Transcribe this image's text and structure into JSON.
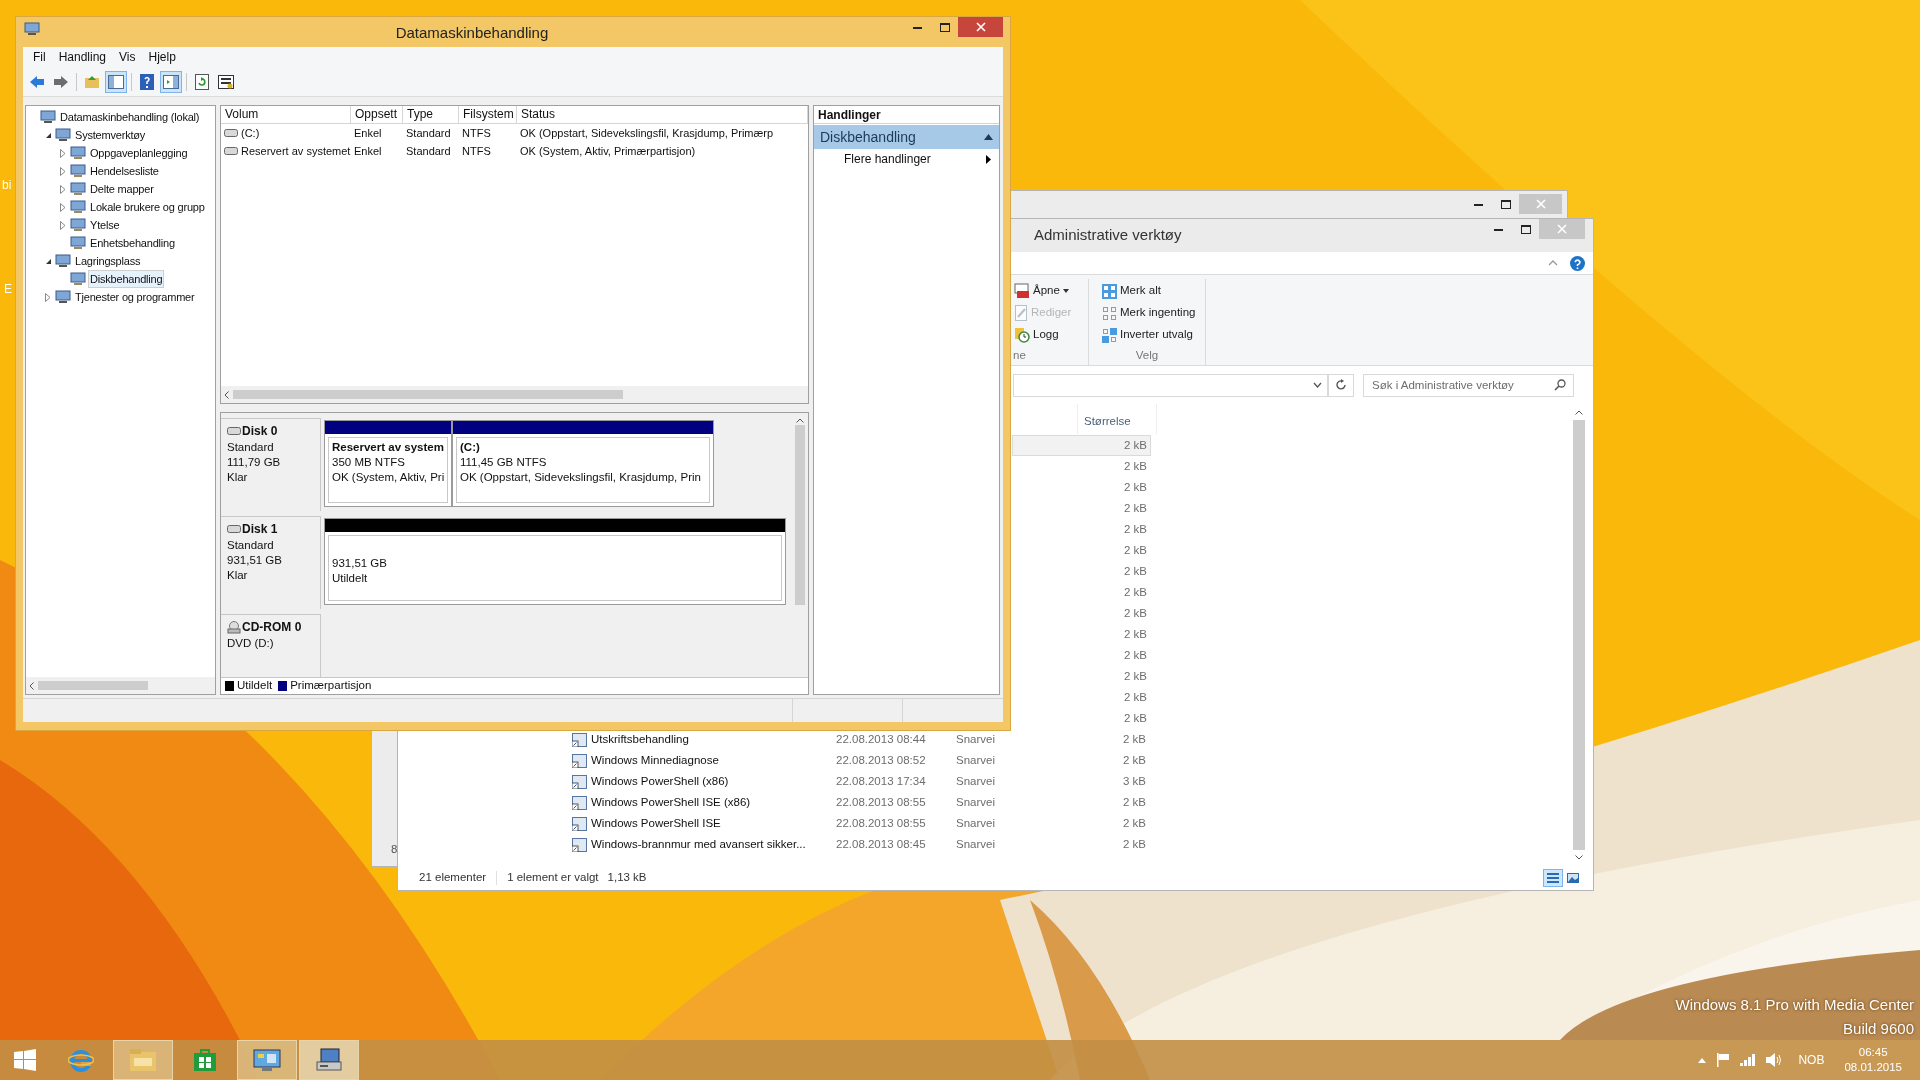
{
  "desktop_fragments": [
    "bi",
    "E"
  ],
  "back_window": {
    "status_fragment": "8"
  },
  "explorer": {
    "title": "Administrative verktøy",
    "ribbon_groups": [
      {
        "label": "ne",
        "items": [
          {
            "kind": "open",
            "label": "Åpne",
            "dropdown": true,
            "disabled": false
          },
          {
            "kind": "edit",
            "label": "Rediger",
            "dropdown": false,
            "disabled": true
          },
          {
            "kind": "log",
            "label": "Logg",
            "dropdown": false,
            "disabled": false
          }
        ]
      },
      {
        "label": "Velg",
        "items": [
          {
            "kind": "select-all",
            "label": "Merk alt",
            "dropdown": false,
            "disabled": false
          },
          {
            "kind": "select-none",
            "label": "Merk ingenting",
            "dropdown": false,
            "disabled": false
          },
          {
            "kind": "invert",
            "label": "Inverter utvalg",
            "dropdown": false,
            "disabled": false
          }
        ]
      }
    ],
    "search": {
      "placeholder": "Søk i Administrative verktøy"
    },
    "columns": [
      "Størrelse"
    ],
    "rows": [
      {
        "size": "2 kB",
        "selected": true
      },
      {
        "size": "2 kB",
        "selected": false
      },
      {
        "size": "2 kB",
        "selected": false
      },
      {
        "size": "2 kB",
        "selected": false
      },
      {
        "size": "2 kB",
        "selected": false
      },
      {
        "size": "2 kB",
        "selected": false
      },
      {
        "size": "2 kB",
        "selected": false
      },
      {
        "size": "2 kB",
        "selected": false
      },
      {
        "size": "2 kB",
        "selected": false
      },
      {
        "size": "2 kB",
        "selected": false
      },
      {
        "size": "2 kB",
        "selected": false
      },
      {
        "size": "2 kB",
        "selected": false
      },
      {
        "size": "2 kB",
        "selected": false
      },
      {
        "size": "2 kB",
        "selected": false
      },
      {
        "name": "Utskriftsbehandling",
        "modified": "22.08.2013 08:44",
        "type": "Snarvei",
        "size": "2 kB",
        "selected": false
      },
      {
        "name": "Windows Minnediagnose",
        "modified": "22.08.2013 08:52",
        "type": "Snarvei",
        "size": "2 kB",
        "selected": false
      },
      {
        "name": "Windows PowerShell (x86)",
        "modified": "22.08.2013 17:34",
        "type": "Snarvei",
        "size": "3 kB",
        "selected": false
      },
      {
        "name": "Windows PowerShell ISE (x86)",
        "modified": "22.08.2013 08:55",
        "type": "Snarvei",
        "size": "2 kB",
        "selected": false
      },
      {
        "name": "Windows PowerShell ISE",
        "modified": "22.08.2013 08:55",
        "type": "Snarvei",
        "size": "2 kB",
        "selected": false
      },
      {
        "name": "Windows-brannmur med avansert sikker...",
        "modified": "22.08.2013 08:45",
        "type": "Snarvei",
        "size": "2 kB",
        "selected": false
      }
    ],
    "status": {
      "count": "21 elementer",
      "selection": "1 element er valgt",
      "selection_size": "1,13 kB"
    },
    "views": [
      {
        "kind": "details",
        "selected": true
      },
      {
        "kind": "large-icons",
        "selected": false
      }
    ]
  },
  "computer_management": {
    "title": "Datamaskinbehandling",
    "menu": [
      "Fil",
      "Handling",
      "Vis",
      "Hjelp"
    ],
    "toolbar": [
      {
        "kind": "back",
        "pressed": false
      },
      {
        "kind": "forward",
        "pressed": false
      },
      {
        "kind": "up",
        "pressed": false
      },
      {
        "kind": "tree-toggle",
        "pressed": true
      },
      {
        "kind": "help",
        "pressed": false
      },
      {
        "kind": "actions-toggle",
        "pressed": true
      },
      {
        "kind": "refresh",
        "pressed": false
      },
      {
        "kind": "properties",
        "pressed": false
      }
    ],
    "tree": [
      {
        "label": "Datamaskinbehandling (lokal)",
        "selected": false,
        "children": [
          {
            "label": "Systemverktøy",
            "expanded": true,
            "selected": false,
            "children": [
              {
                "label": "Oppgaveplanlegging",
                "expanded": false,
                "selected": false
              },
              {
                "label": "Hendelsesliste",
                "expanded": false,
                "selected": false
              },
              {
                "label": "Delte mapper",
                "expanded": false,
                "selected": false
              },
              {
                "label": "Lokale brukere og grupp",
                "expanded": false,
                "selected": false
              },
              {
                "label": "Ytelse",
                "expanded": false,
                "selected": false
              },
              {
                "label": "Enhetsbehandling",
                "selected": false
              }
            ]
          },
          {
            "label": "Lagringsplass",
            "expanded": true,
            "selected": false,
            "children": [
              {
                "label": "Diskbehandling",
                "selected": true
              }
            ]
          },
          {
            "label": "Tjenester og programmer",
            "expanded": false,
            "selected": false
          }
        ]
      }
    ],
    "volume_table": {
      "columns": [
        "Volum",
        "Oppsett",
        "Type",
        "Filsystem",
        "Status"
      ],
      "rows": [
        {
          "volume": "(C:)",
          "layout": "Enkel",
          "type": "Standard",
          "filesystem": "NTFS",
          "status": "OK (Oppstart, Sidevekslingsfil, Krasjdump, Primærp"
        },
        {
          "volume": "Reservert av systemet",
          "layout": "Enkel",
          "type": "Standard",
          "filesystem": "NTFS",
          "status": "OK (System, Aktiv, Primærpartisjon)"
        }
      ]
    },
    "disks": [
      {
        "kind": "disk",
        "name": "Disk 0",
        "details": [
          "Standard",
          "111,79 GB",
          "Klar"
        ],
        "partitions": [
          {
            "kind": "primary",
            "title": "Reservert av system",
            "size": "350 MB NTFS",
            "status": "OK (System, Aktiv, Pri"
          },
          {
            "kind": "primary",
            "title": "(C:)",
            "size": "111,45 GB NTFS",
            "status": "OK (Oppstart, Sidevekslingsfil, Krasjdump, Prin"
          }
        ]
      },
      {
        "kind": "disk",
        "name": "Disk 1",
        "details": [
          "Standard",
          "931,51 GB",
          "Klar"
        ],
        "partitions": [
          {
            "kind": "unallocated",
            "size": "931,51 GB",
            "status": "Utildelt"
          }
        ]
      },
      {
        "kind": "cdrom",
        "name": "CD-ROM 0",
        "details": [
          "DVD (D:)"
        ]
      }
    ],
    "legend": [
      {
        "label": "Utildelt",
        "color": "#000000"
      },
      {
        "label": "Primærpartisjon",
        "color": "#000080"
      }
    ],
    "actions": {
      "header": "Handlinger",
      "section": {
        "label": "Diskbehandling",
        "expanded": true
      },
      "items": [
        "Flere handlinger"
      ]
    }
  },
  "os_version_text": [
    "Windows 8.1 Pro with Media Center",
    "Build 9600"
  ],
  "taskbar": {
    "items": [
      {
        "kind": "start",
        "running": false,
        "active": false
      },
      {
        "kind": "browser",
        "running": false,
        "active": false
      },
      {
        "kind": "file-explorer",
        "running": true,
        "active": false
      },
      {
        "kind": "store",
        "running": false,
        "active": false
      },
      {
        "kind": "control-panel",
        "running": true,
        "active": false
      },
      {
        "kind": "computer-management",
        "running": true,
        "active": true
      }
    ],
    "language": "NOB",
    "time": "06:45",
    "date": "08.01.2015"
  }
}
